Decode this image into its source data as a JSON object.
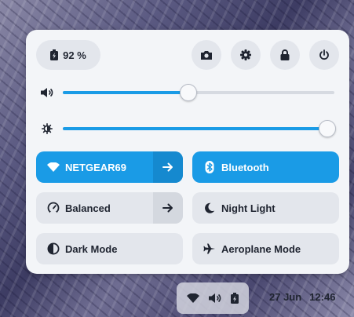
{
  "battery": {
    "percent": "92 %"
  },
  "header_buttons": [
    "camera-icon",
    "gear-icon",
    "lock-icon",
    "power-icon"
  ],
  "volume": {
    "icon": "speaker-icon",
    "level": 0.46
  },
  "brightness": {
    "icon": "brightness-icon",
    "level": 0.97
  },
  "tiles": {
    "wifi": {
      "label": "NETGEAR69",
      "active": true
    },
    "bluetooth": {
      "label": "Bluetooth",
      "active": true
    },
    "power_mode": {
      "label": "Balanced",
      "active": false
    },
    "night_light": {
      "label": "Night Light",
      "active": false
    },
    "dark_mode": {
      "label": "Dark Mode",
      "active": false
    },
    "aeroplane_mode": {
      "label": "Aeroplane Mode",
      "active": false
    }
  },
  "taskbar": {
    "tray_icons": [
      "wifi-icon",
      "speaker-icon",
      "battery-icon"
    ],
    "date": "27 Jun",
    "time": "12:46"
  },
  "colors": {
    "accent": "#1a9be6",
    "panel": "#f3f5f8",
    "tile": "#e3e6ec"
  }
}
